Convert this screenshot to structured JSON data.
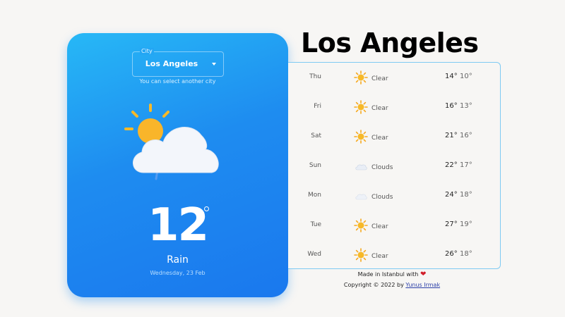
{
  "card": {
    "city_label": "City",
    "city_value": "Los Angeles",
    "helper": "You can select another city",
    "temperature": "12",
    "condition": "Rain",
    "date": "Wednesday, 23 Feb",
    "icon": "sun-cloud-rain-icon"
  },
  "title": "Los Angeles",
  "forecast": [
    {
      "day": "Thu",
      "icon": "sun-icon",
      "condition": "Clear",
      "high": "14°",
      "low": "10°"
    },
    {
      "day": "Fri",
      "icon": "sun-icon",
      "condition": "Clear",
      "high": "16°",
      "low": "13°"
    },
    {
      "day": "Sat",
      "icon": "sun-icon",
      "condition": "Clear",
      "high": "21°",
      "low": "16°"
    },
    {
      "day": "Sun",
      "icon": "cloud-icon",
      "condition": "Clouds",
      "high": "22°",
      "low": "17°"
    },
    {
      "day": "Mon",
      "icon": "cloud-icon",
      "condition": "Clouds",
      "high": "24°",
      "low": "18°"
    },
    {
      "day": "Tue",
      "icon": "sun-icon",
      "condition": "Clear",
      "high": "27°",
      "low": "19°"
    },
    {
      "day": "Wed",
      "icon": "sun-icon",
      "condition": "Clear",
      "high": "26°",
      "low": "18°"
    }
  ],
  "footer": {
    "made_in": "Made in Istanbul with",
    "heart": "❤",
    "copyright": "Copyright © 2022 by",
    "author": "Yunus Irmak"
  },
  "colors": {
    "card_top": "#27b8f6",
    "card_bottom": "#1a78ee",
    "sun": "#f7b928",
    "heart": "#d11f2a",
    "border": "#7ecaf2"
  }
}
